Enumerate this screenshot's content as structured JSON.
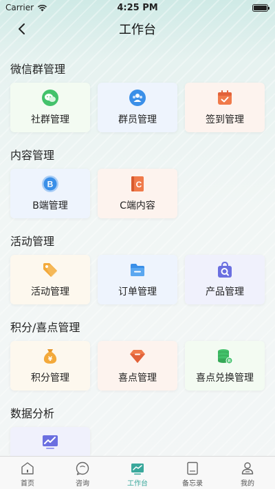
{
  "status_bar": {
    "carrier": "Carrier",
    "time": "4:25 PM",
    "battery_level": 1.0
  },
  "nav": {
    "title": "工作台"
  },
  "sections": [
    {
      "title": "微信群管理",
      "items": [
        {
          "label": "社群管理",
          "icon": "wechat-group-icon"
        },
        {
          "label": "群员管理",
          "icon": "members-icon"
        },
        {
          "label": "签到管理",
          "icon": "calendar-check-icon"
        }
      ]
    },
    {
      "title": "内容管理",
      "items": [
        {
          "label": "B端管理",
          "icon": "b-circle-icon"
        },
        {
          "label": "C端内容",
          "icon": "c-book-icon"
        }
      ]
    },
    {
      "title": "活动管理",
      "items": [
        {
          "label": "活动管理",
          "icon": "tag-icon"
        },
        {
          "label": "订单管理",
          "icon": "folder-icon"
        },
        {
          "label": "产品管理",
          "icon": "shopping-bag-search-icon"
        }
      ]
    },
    {
      "title": "积分/喜点管理",
      "items": [
        {
          "label": "积分管理",
          "icon": "money-bag-icon"
        },
        {
          "label": "喜点管理",
          "icon": "diamond-icon"
        },
        {
          "label": "喜点兑换管理",
          "icon": "coin-stack-icon"
        }
      ]
    },
    {
      "title": "数据分析",
      "items": [
        {
          "label": "",
          "icon": "chart-monitor-icon"
        }
      ]
    }
  ],
  "tabs": [
    {
      "label": "首页",
      "icon": "home-icon",
      "active": false
    },
    {
      "label": "咨询",
      "icon": "chat-bubble-icon",
      "active": false
    },
    {
      "label": "工作台",
      "icon": "workbench-icon",
      "active": true
    },
    {
      "label": "备忘录",
      "icon": "notebook-icon",
      "active": false
    },
    {
      "label": "我的",
      "icon": "user-icon",
      "active": false
    }
  ],
  "colors": {
    "accent": "#3aa89c",
    "green": "#43c26b",
    "blue": "#3a8fe8",
    "orange": "#f07a4a",
    "gold": "#f3a93a",
    "purple": "#6b6fe0"
  }
}
